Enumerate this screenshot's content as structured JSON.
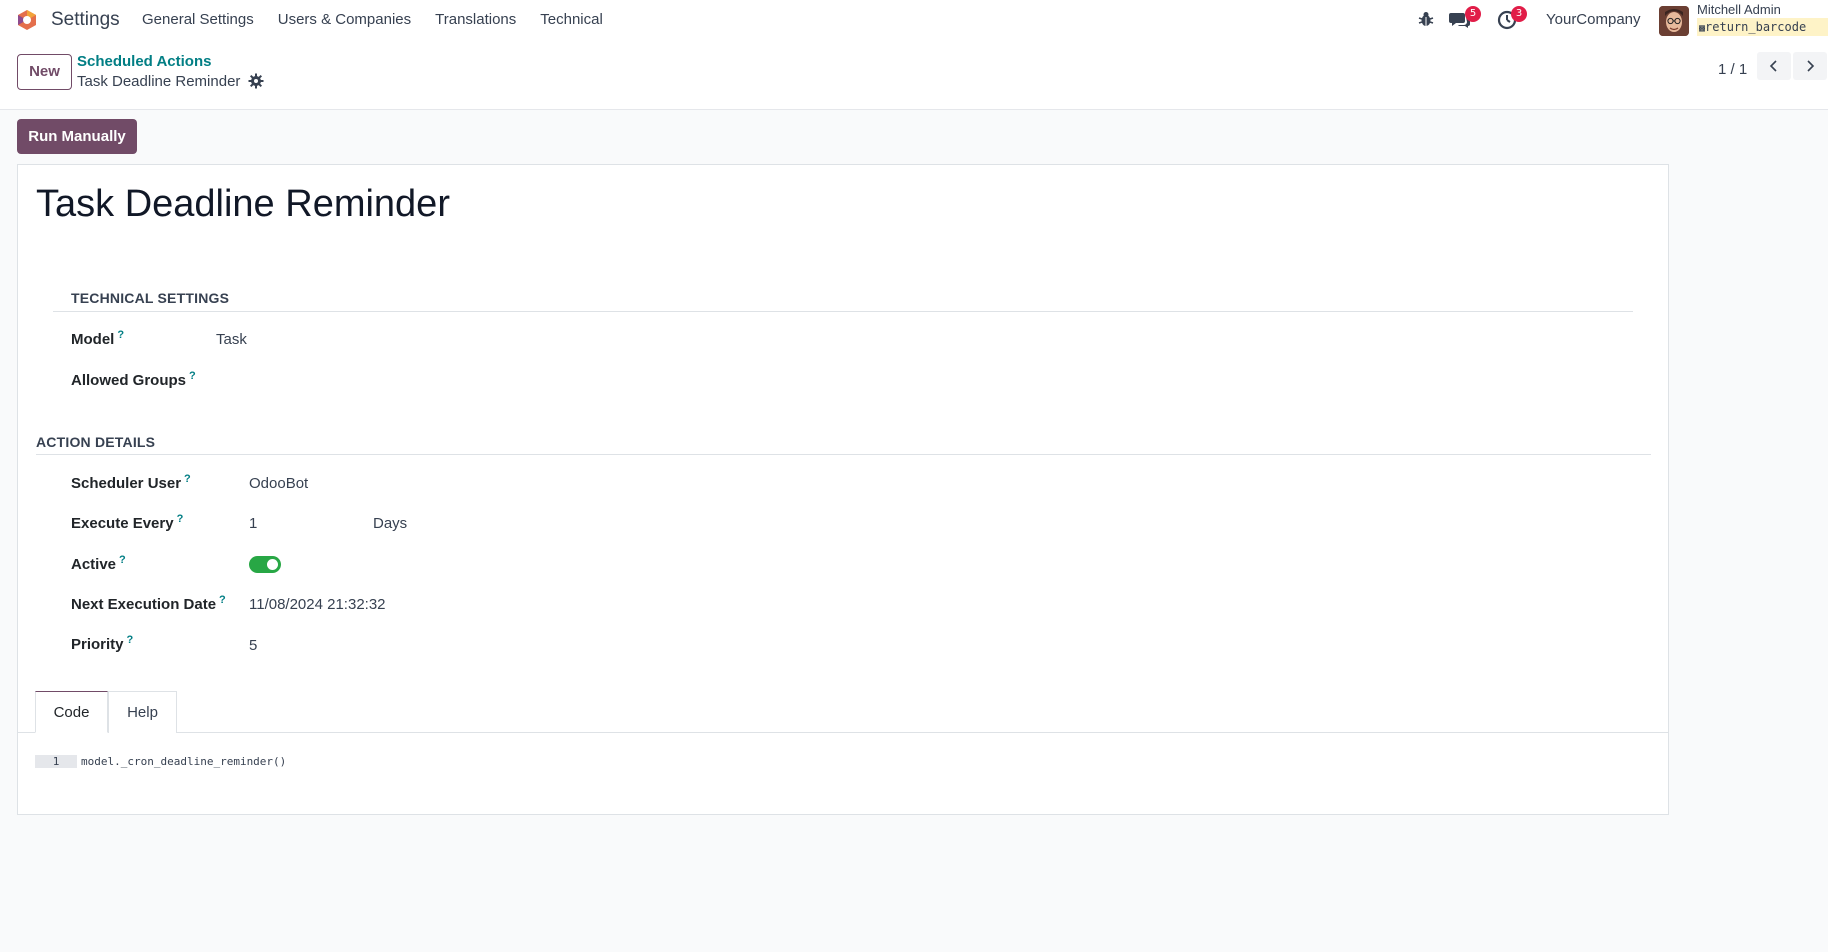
{
  "navbar": {
    "app_name": "Settings",
    "menu": [
      "General Settings",
      "Users & Companies",
      "Translations",
      "Technical"
    ],
    "messages_count": "5",
    "activities_count": "3",
    "company": "YourCompany",
    "user_name": "Mitchell Admin",
    "database": "return_barcode"
  },
  "control_panel": {
    "new_label": "New",
    "breadcrumb_parent": "Scheduled Actions",
    "breadcrumb_current": "Task Deadline Reminder",
    "pager": "1 / 1"
  },
  "actions": {
    "run_manually_label": "Run Manually"
  },
  "form": {
    "title": "Task Deadline Reminder",
    "technical_settings": {
      "title": "TECHNICAL SETTINGS",
      "model_label": "Model",
      "model_value": "Task",
      "allowed_groups_label": "Allowed Groups",
      "allowed_groups_value": ""
    },
    "action_details": {
      "title": "ACTION DETAILS",
      "scheduler_user_label": "Scheduler User",
      "scheduler_user_value": "OdooBot",
      "execute_every_label": "Execute Every",
      "execute_every_value": "1",
      "execute_every_unit": "Days",
      "active_label": "Active",
      "active_value": true,
      "next_execution_label": "Next Execution Date",
      "next_execution_value": "11/08/2024 21:32:32",
      "priority_label": "Priority",
      "priority_value": "5"
    },
    "tabs": [
      "Code",
      "Help"
    ],
    "code": {
      "line_number": "1",
      "line": "model._cron_deadline_reminder()"
    },
    "help_mark": "?"
  },
  "colors": {
    "primary": "#714b67",
    "link": "#017e84",
    "badge": "#e11d48",
    "toggle_on": "#28a745"
  }
}
